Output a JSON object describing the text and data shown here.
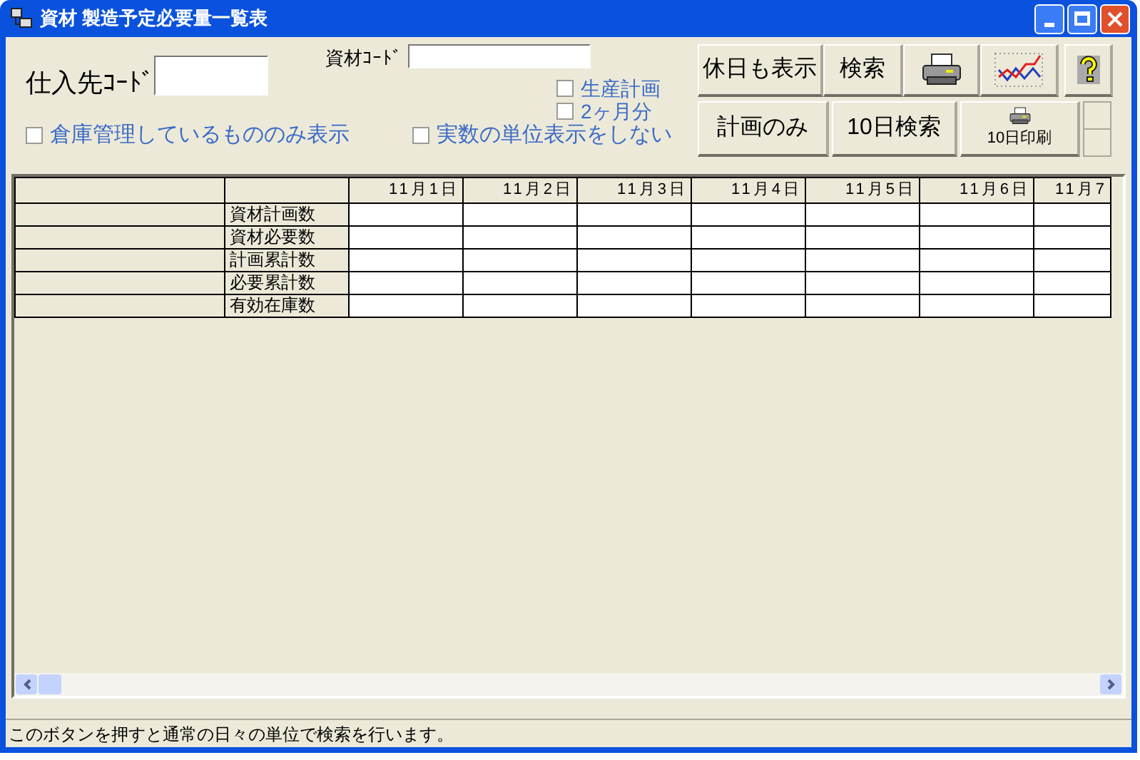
{
  "window": {
    "title": "資材 製造予定必要量一覧表"
  },
  "supplier_code": {
    "label": "仕入先ｺｰﾄﾞ"
  },
  "material_code": {
    "label": "資材ｺｰﾄﾞ"
  },
  "checkboxes": [
    {
      "label": "生産計画",
      "checked": false
    },
    {
      "label": "2ヶ月分",
      "checked": false
    },
    {
      "label": "倉庫管理しているもののみ表示",
      "checked": false
    },
    {
      "label": "実数の単位表示をしない",
      "checked": false
    }
  ],
  "toolbar_top": [
    {
      "kind": "text",
      "label": "休日も表示"
    },
    {
      "kind": "text",
      "label": "検索"
    },
    {
      "kind": "printer"
    },
    {
      "kind": "chart"
    },
    {
      "kind": "help"
    }
  ],
  "toolbar_bottom": [
    {
      "kind": "text",
      "label": "計画のみ"
    },
    {
      "kind": "text",
      "label": "10日検索"
    },
    {
      "kind": "printer-text",
      "label": "10日印刷"
    }
  ],
  "table": {
    "columns": [
      "11月1日",
      "11月2日",
      "11月3日",
      "11月4日",
      "11月5日",
      "11月6日",
      "11月7"
    ],
    "rows": [
      "資材計画数",
      "資材必要数",
      "計画累計数",
      "必要累計数",
      "有効在庫数"
    ]
  },
  "status_bar": "このボタンを押すと通常の日々の単位で検索を行います。"
}
